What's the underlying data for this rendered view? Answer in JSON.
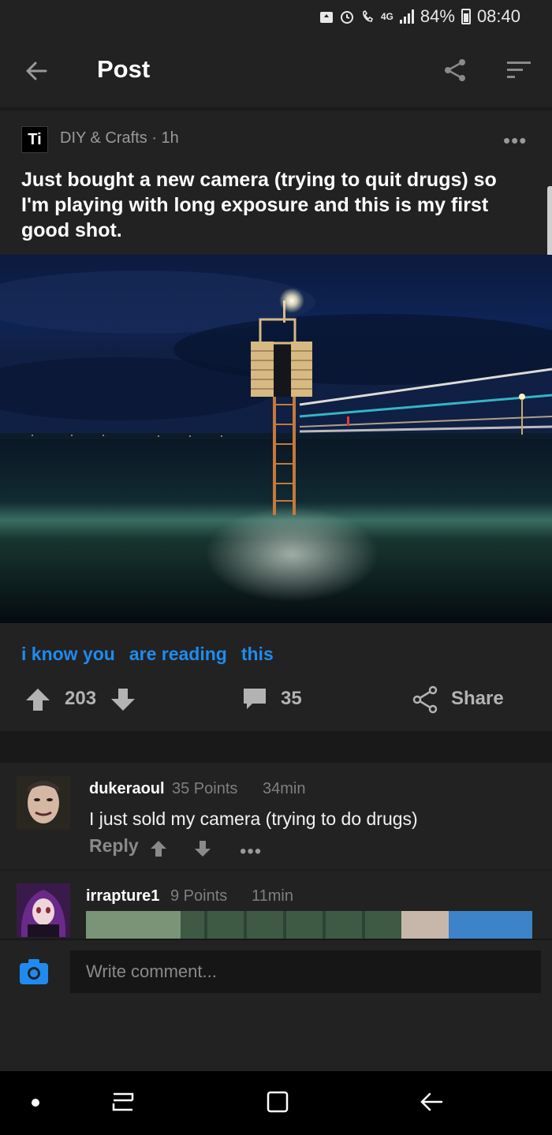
{
  "status_bar": {
    "network": "4G",
    "battery": "84%",
    "time": "08:40"
  },
  "app_bar": {
    "title": "Post"
  },
  "post": {
    "section_icon_text": "Ti",
    "section_meta": "DIY & Crafts · 1h",
    "title": "Just bought a new camera (trying to quit drugs) so I'm playing with long exposure and this is my first good shot.",
    "tags": [
      "i know you",
      "are reading",
      "this"
    ],
    "points": "203",
    "comment_count": "35",
    "share_label": "Share"
  },
  "comments": [
    {
      "user": "dukeraoul",
      "points": "35 Points",
      "time": "34min",
      "text": "I just sold my camera (trying to do drugs)",
      "reply_label": "Reply"
    },
    {
      "user": "irrapture1",
      "points": "9 Points",
      "time": "11min"
    }
  ],
  "composer": {
    "placeholder": "Write comment..."
  },
  "colors": {
    "background": "#222222",
    "accent_blue": "#1f8bf0",
    "nav_bar": "#000000"
  }
}
